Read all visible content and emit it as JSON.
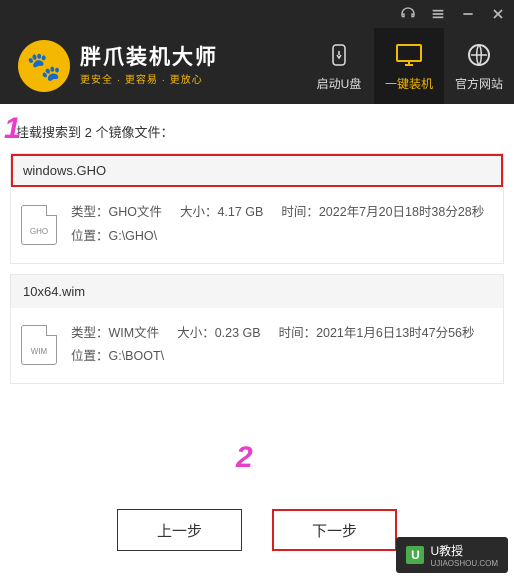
{
  "titlebar": {
    "headset_icon": "headset",
    "menu_icon": "menu",
    "minimize_icon": "minimize",
    "close_icon": "close"
  },
  "brand": {
    "title": "胖爪装机大师",
    "subtitle": "更安全 · 更容易 · 更放心"
  },
  "nav": {
    "boot_usb": "启动U盘",
    "one_click": "一键装机",
    "official_site": "官方网站"
  },
  "search": {
    "label": "挂载搜索到 2 个镜像文件："
  },
  "files": [
    {
      "name": "windows.GHO",
      "icon_label": "GHO",
      "type_label": "类型：GHO文件",
      "size_label": "大小：4.17 GB",
      "time_label": "时间：2022年7月20日18时38分28秒",
      "location_label": "位置：G:\\GHO\\",
      "selected": true
    },
    {
      "name": "10x64.wim",
      "icon_label": "WIM",
      "type_label": "类型：WIM文件",
      "size_label": "大小：0.23 GB",
      "time_label": "时间：2021年1月6日13时47分56秒",
      "location_label": "位置：G:\\BOOT\\",
      "selected": false
    }
  ],
  "buttons": {
    "prev": "上一步",
    "next": "下一步"
  },
  "annotations": {
    "one": "1",
    "two": "2"
  },
  "watermark": {
    "text": "U教授",
    "sub": "UJIAOSHOU.COM"
  }
}
